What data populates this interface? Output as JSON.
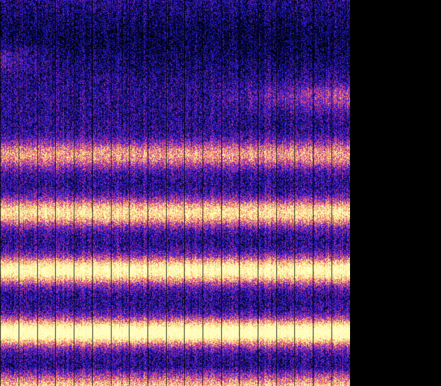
{
  "image": {
    "subject": "waterfall-spectrogram",
    "palette": [
      "#000000",
      "#0a0a6e",
      "#2020e0",
      "#7a20c8",
      "#d83a8a",
      "#f07a5a",
      "#f6e27a",
      "#fffdc0"
    ],
    "background_color": "#000000",
    "divider_color": "#000000",
    "bright_bands": [
      {
        "level": 0.25,
        "strength": 0.35,
        "extent": "right-half"
      },
      {
        "level": 0.15,
        "strength": 0.25,
        "extent": "left-edge"
      },
      {
        "level": 0.4,
        "strength": 0.55,
        "extent": "full"
      },
      {
        "level": 0.55,
        "strength": 0.75,
        "extent": "full"
      },
      {
        "level": 0.7,
        "strength": 0.9,
        "extent": "full"
      },
      {
        "level": 0.86,
        "strength": 1.0,
        "extent": "full"
      }
    ],
    "dark_region": {
      "level": 0.05,
      "strength": 0.6
    }
  }
}
